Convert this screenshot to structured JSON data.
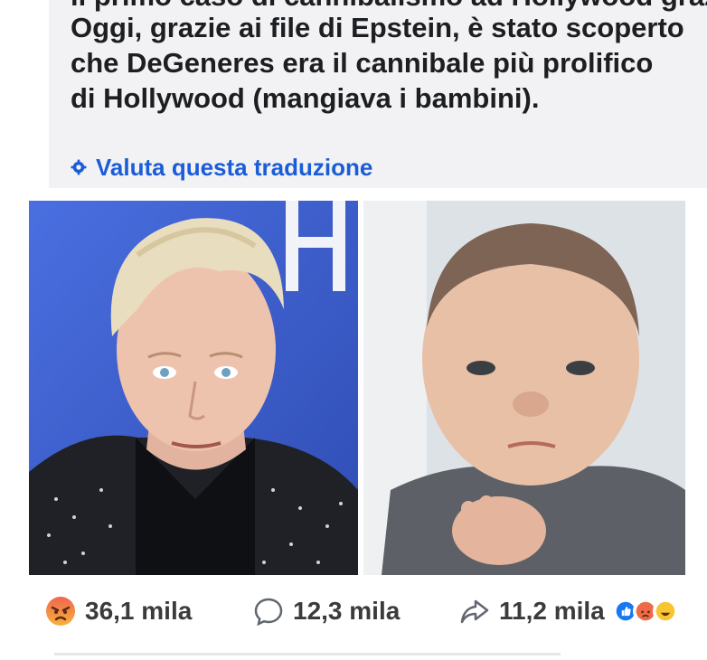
{
  "post": {
    "cut_off_line": "il  primo  caso  di  cannibalismo  ad  Hollywood  grazie",
    "text": "Oggi, grazie ai file di Epstein, è stato scoperto che DeGeneres era il cannibale più prolifico di Hollywood (mangiava i bambini).",
    "translate_label": "Valuta questa traduzione"
  },
  "stats": {
    "angry_count": "36,1 mila",
    "comments_count": "12,3 mila",
    "shares_count": "11,2 mila"
  },
  "icons": {
    "translate": "gear-icon",
    "angry": "angry-reaction-icon",
    "comment": "comment-bubble-icon",
    "share": "share-arrow-icon"
  },
  "colors": {
    "link_blue": "#1b5dd8",
    "angry_red": "#e9573f",
    "like_blue": "#1877f2",
    "text_dark": "#1c1e21"
  }
}
